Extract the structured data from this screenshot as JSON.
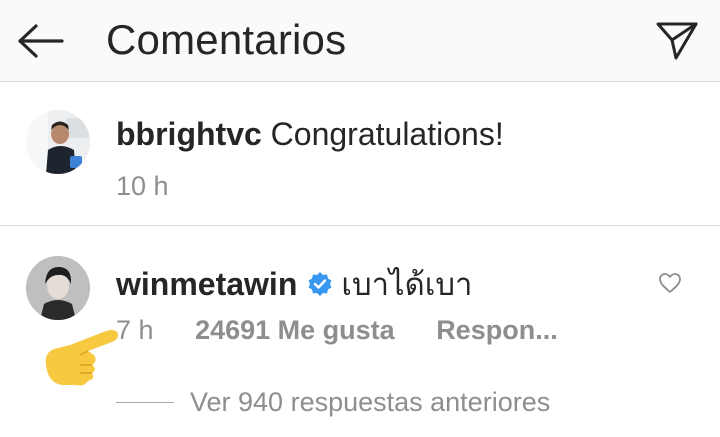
{
  "header": {
    "title": "Comentarios",
    "back_icon": "arrow-left-icon",
    "send_icon": "paper-plane-icon"
  },
  "caption": {
    "username": "bbrightvc",
    "text": "Congratulations!",
    "time": "10 h"
  },
  "comment": {
    "username": "winmetawin",
    "verified": true,
    "text": "เบาได้เบา",
    "time": "7 h",
    "likes": "24691 Me gusta",
    "reply_label": "Respon...",
    "view_replies": "Ver 940 respuestas anteriores"
  },
  "colors": {
    "text": "#262626",
    "muted": "#8e8e8e",
    "verified": "#3897f0",
    "divider": "#dbdbdb",
    "header_bg": "#fafafa"
  }
}
